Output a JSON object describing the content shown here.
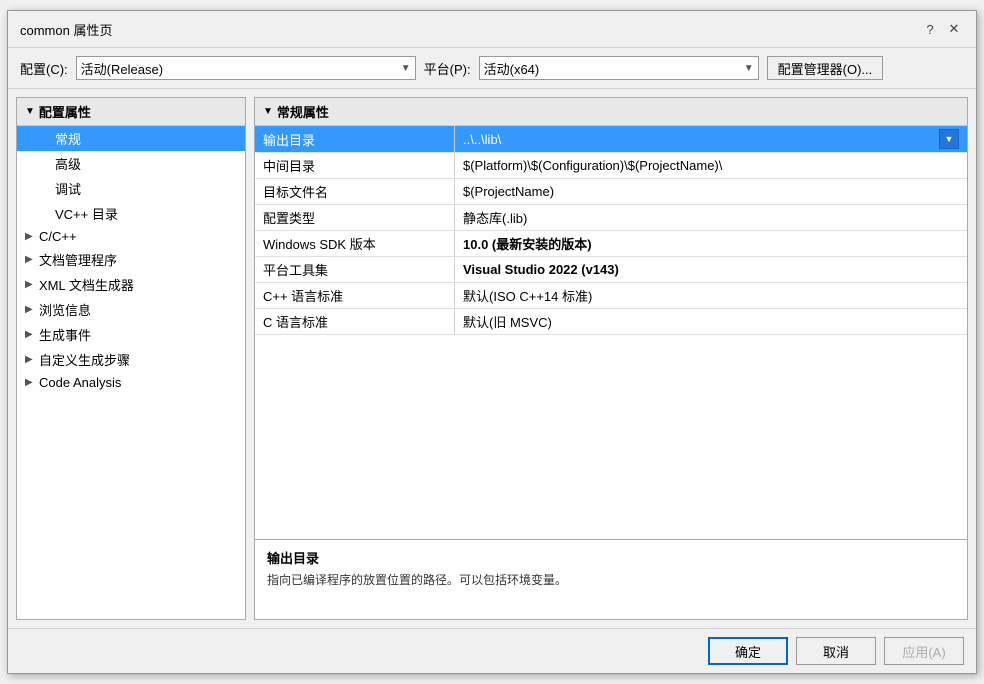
{
  "dialog": {
    "title": "common 属性页",
    "help_btn": "?",
    "close_btn": "✕"
  },
  "toolbar": {
    "config_label": "配置(C):",
    "config_value": "活动(Release)",
    "platform_label": "平台(P):",
    "platform_value": "活动(x64)",
    "config_manager_label": "配置管理器(O)..."
  },
  "left_panel": {
    "header": "配置属性",
    "items": [
      {
        "id": "gen",
        "label": "常规",
        "indent": 1,
        "expandable": false,
        "selected": true
      },
      {
        "id": "adv",
        "label": "高级",
        "indent": 1,
        "expandable": false,
        "selected": false
      },
      {
        "id": "debug",
        "label": "调试",
        "indent": 1,
        "expandable": false,
        "selected": false
      },
      {
        "id": "vc",
        "label": "VC++ 目录",
        "indent": 1,
        "expandable": false,
        "selected": false
      },
      {
        "id": "cpp",
        "label": "C/C++",
        "indent": 0,
        "expandable": true,
        "selected": false
      },
      {
        "id": "linker",
        "label": "文档管理程序",
        "indent": 0,
        "expandable": true,
        "selected": false
      },
      {
        "id": "xml",
        "label": "XML 文档生成器",
        "indent": 0,
        "expandable": true,
        "selected": false
      },
      {
        "id": "browse",
        "label": "浏览信息",
        "indent": 0,
        "expandable": true,
        "selected": false
      },
      {
        "id": "build",
        "label": "生成事件",
        "indent": 0,
        "expandable": true,
        "selected": false
      },
      {
        "id": "custom",
        "label": "自定义生成步骤",
        "indent": 0,
        "expandable": true,
        "selected": false
      },
      {
        "id": "code",
        "label": "Code Analysis",
        "indent": 0,
        "expandable": true,
        "selected": false
      }
    ]
  },
  "right_panel": {
    "header": "常规属性",
    "properties": [
      {
        "id": "output_dir",
        "name": "输出目录",
        "value": "..\\..\\lib\\",
        "bold": false,
        "selected": true,
        "has_dropdown": true
      },
      {
        "id": "inter_dir",
        "name": "中间目录",
        "value": "$(Platform)\\$(Configuration)\\$(ProjectName)\\",
        "bold": false,
        "selected": false,
        "has_dropdown": false
      },
      {
        "id": "target_name",
        "name": "目标文件名",
        "value": "$(ProjectName)",
        "bold": false,
        "selected": false,
        "has_dropdown": false
      },
      {
        "id": "config_type",
        "name": "配置类型",
        "value": "静态库(.lib)",
        "bold": false,
        "selected": false,
        "has_dropdown": false
      },
      {
        "id": "sdk_ver",
        "name": "Windows SDK 版本",
        "value": "10.0 (最新安装的版本)",
        "bold": true,
        "selected": false,
        "has_dropdown": false
      },
      {
        "id": "toolset",
        "name": "平台工具集",
        "value": "Visual Studio 2022 (v143)",
        "bold": true,
        "selected": false,
        "has_dropdown": false
      },
      {
        "id": "cpp_std",
        "name": "C++ 语言标准",
        "value": "默认(ISO C++14 标准)",
        "bold": false,
        "selected": false,
        "has_dropdown": false
      },
      {
        "id": "c_std",
        "name": "C 语言标准",
        "value": "默认(旧 MSVC)",
        "bold": false,
        "selected": false,
        "has_dropdown": false
      }
    ]
  },
  "description": {
    "title": "输出目录",
    "text": "指向已编译程序的放置位置的路径。可以包括环境变量。"
  },
  "footer": {
    "ok_label": "确定",
    "cancel_label": "取消",
    "apply_label": "应用(A)"
  }
}
